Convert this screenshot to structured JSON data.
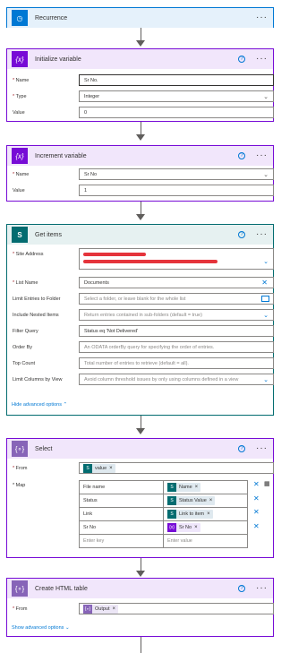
{
  "recurrence": {
    "title": "Recurrence",
    "color": "#0078d4"
  },
  "init_variable": {
    "title": "Initialize variable",
    "color": "#770bd6",
    "fields": [
      {
        "label": "Name",
        "required": true,
        "value": "Sr No."
      },
      {
        "label": "Type",
        "required": true,
        "value": "Integer"
      },
      {
        "label": "Value",
        "required": false,
        "value": "0"
      }
    ]
  },
  "increment_variable": {
    "title": "Increment variable",
    "fields": [
      {
        "label": "Name",
        "required": true,
        "value": "Sr No"
      },
      {
        "label": "Value",
        "required": false,
        "value": "1"
      }
    ]
  },
  "get_items": {
    "title": "Get items",
    "color": "#036c70",
    "fields": [
      {
        "label": "Site Address",
        "required": true,
        "value": ""
      },
      {
        "label": "List Name",
        "required": true,
        "value": "Documents"
      },
      {
        "label": "Limit Entries to Folder",
        "required": false,
        "placeholder": "Select a folder, or leave blank for the whole list"
      },
      {
        "label": "Include Nested Items",
        "required": false,
        "placeholder": "Return entries contained in sub-folders (default = true)"
      },
      {
        "label": "Filter Query",
        "required": false,
        "value": "Status eq 'Not Delivered'"
      },
      {
        "label": "Order By",
        "required": false,
        "placeholder": "An ODATA orderBy query for specifying the order of entries."
      },
      {
        "label": "Top Count",
        "required": false,
        "placeholder": "Total number of entries to retrieve (default = all)."
      },
      {
        "label": "Limit Columns by View",
        "required": false,
        "placeholder": "Avoid column threshold issues by only using columns defined in a view"
      }
    ],
    "hide_advanced": "Hide advanced options"
  },
  "select": {
    "title": "Select",
    "from_label": "From",
    "from_token": "value",
    "map_label": "Map",
    "map_rows": [
      {
        "key": "File name",
        "value_token": "Name",
        "token_kind": "sharepoint"
      },
      {
        "key": "Status",
        "value_token": "Status Value",
        "token_kind": "sharepoint"
      },
      {
        "key": "Link",
        "value_token": "Link to item",
        "token_kind": "sharepoint"
      },
      {
        "key": "Sr No",
        "value_token": "Sr No",
        "token_kind": "variable"
      }
    ],
    "key_placeholder": "Enter key",
    "value_placeholder": "Enter value"
  },
  "html_table": {
    "title": "Create HTML table",
    "from_label": "From",
    "from_token": "Output",
    "show_advanced": "Show advanced options"
  }
}
